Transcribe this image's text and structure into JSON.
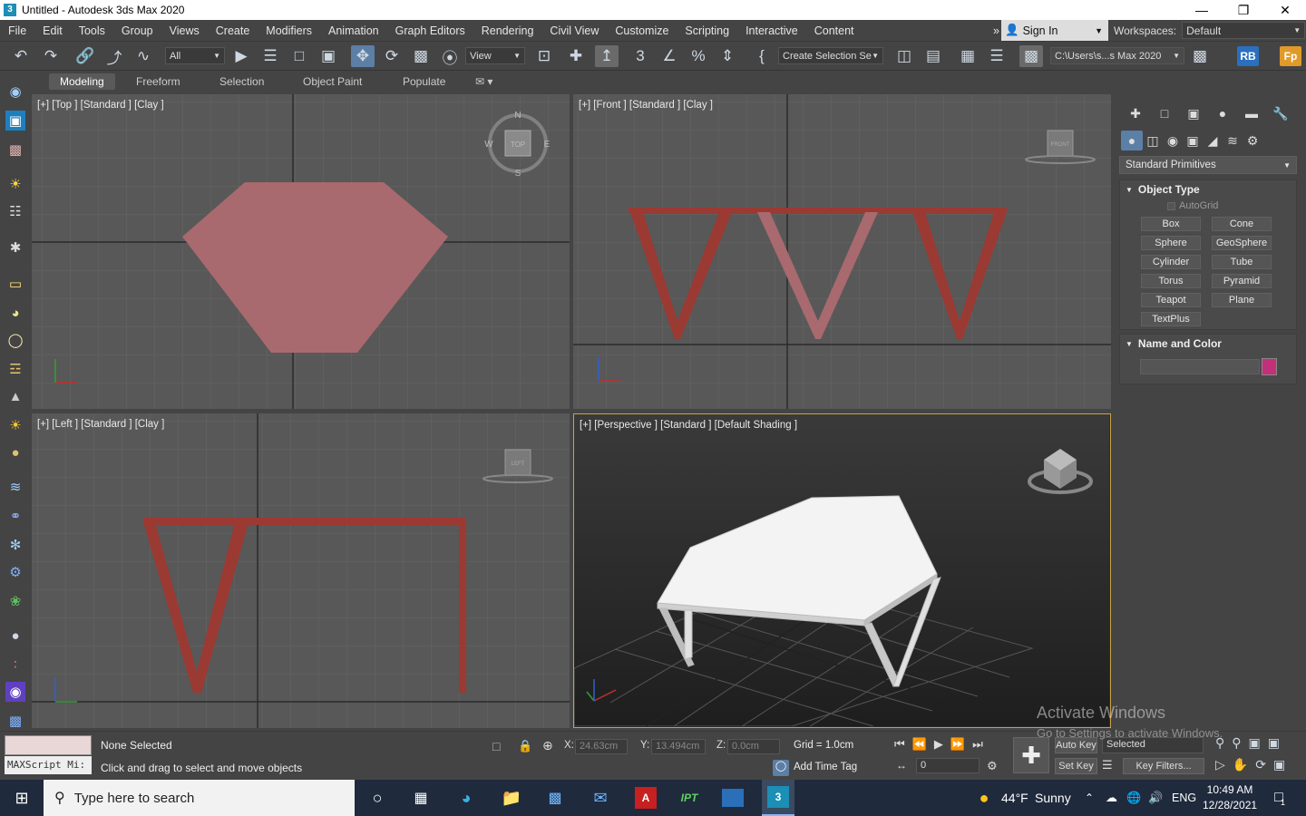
{
  "window": {
    "title": "Untitled - Autodesk 3ds Max 2020",
    "app_icon": "3",
    "minimize": "—",
    "maximize": "❐",
    "close": "✕"
  },
  "menu": [
    "File",
    "Edit",
    "Tools",
    "Group",
    "Views",
    "Create",
    "Modifiers",
    "Animation",
    "Graph Editors",
    "Rendering",
    "Civil View",
    "Customize",
    "Scripting",
    "Interactive",
    "Content"
  ],
  "menu_more": "»",
  "sign_in": "Sign In",
  "workspaces": {
    "label": "Workspaces:",
    "value": "Default"
  },
  "toolbar": {
    "filter": "All",
    "ref_coord": "View",
    "selection_set": "Create Selection Se",
    "project_path": "C:\\Users\\s...s Max 2020",
    "rb_badge": "RB",
    "fp_badge": "Fp"
  },
  "ribbon": {
    "tabs": [
      "Modeling",
      "Freeform",
      "Selection",
      "Object Paint",
      "Populate"
    ],
    "active": "Modeling"
  },
  "viewports": {
    "top": {
      "label": "[+] [Top ] [Standard ] [Clay ]",
      "compass": {
        "n": "N",
        "s": "S",
        "e": "E",
        "w": "W",
        "cube": "TOP"
      }
    },
    "front": {
      "label": "[+] [Front ] [Standard ] [Clay ]",
      "cube": "FRONT"
    },
    "left": {
      "label": "[+] [Left ] [Standard ] [Clay ]",
      "cube": "LEFT"
    },
    "perspective": {
      "label": "[+] [Perspective ] [Standard ] [Default Shading ]"
    }
  },
  "command_panel": {
    "dropdown": "Standard Primitives",
    "object_type": {
      "header": "Object Type",
      "autogrid": "AutoGrid",
      "buttons": [
        "Box",
        "Cone",
        "Sphere",
        "GeoSphere",
        "Cylinder",
        "Tube",
        "Torus",
        "Pyramid",
        "Teapot",
        "Plane",
        "TextPlus"
      ]
    },
    "name_color": {
      "header": "Name and Color",
      "name_value": "",
      "color": "#c2307a"
    }
  },
  "status": {
    "maxscript": "MAXScript Mi:",
    "selection": "None Selected",
    "prompt": "Click and drag to select and move objects",
    "x_label": "X:",
    "x_value": "24.63cm",
    "y_label": "Y:",
    "y_value": "13.494cm",
    "z_label": "Z:",
    "z_value": "0.0cm",
    "grid": "Grid = 1.0cm",
    "add_time_tag": "Add Time Tag",
    "auto_key": "Auto Key",
    "set_key": "Set Key",
    "key_mode": "Selected",
    "key_filters": "Key Filters...",
    "frame": "0"
  },
  "watermark": {
    "line1": "Activate Windows",
    "line2": "Go to Settings to activate Windows."
  },
  "taskbar": {
    "search_placeholder": "Type here to search",
    "weather_temp": "44°F",
    "weather_text": "Sunny",
    "lang": "ENG",
    "time": "10:49 AM",
    "date": "12/28/2021",
    "notif_count": "1"
  },
  "colors": {
    "clay_red": "#9b3a33",
    "table_top_top": "#a86a6e",
    "accent_blue": "#5c7fa5",
    "perspective_border": "#c9a24a"
  }
}
